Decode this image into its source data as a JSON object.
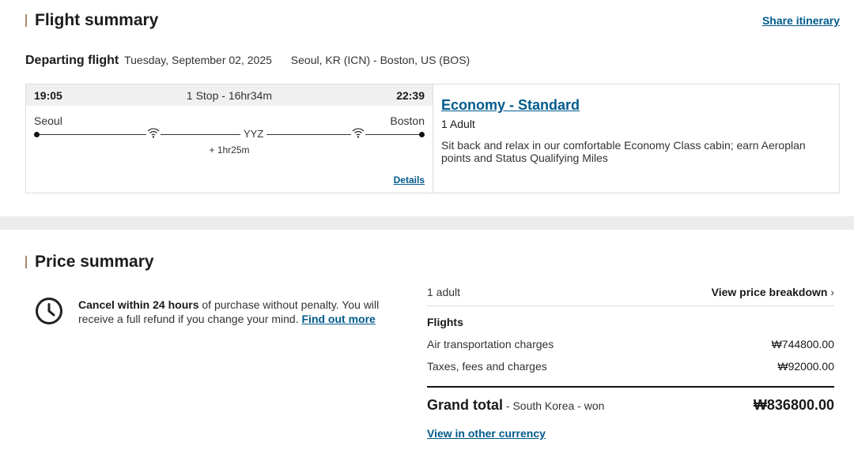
{
  "flight_summary": {
    "title": "Flight summary",
    "share_link": "Share itinerary",
    "departing_label": "Departing flight",
    "date": "Tuesday, September 02, 2025",
    "route": "Seoul, KR (ICN) - Boston, US (BOS)",
    "segment": {
      "dep_time": "19:05",
      "stops": "1 Stop - 16hr34m",
      "arr_time": "22:39",
      "dep_city": "Seoul",
      "arr_city": "Boston",
      "stop_code": "YYZ",
      "layover": "+ 1hr25m",
      "details_link": "Details"
    },
    "fare": {
      "title": "Economy - Standard",
      "passengers": "1 Adult",
      "description": "Sit back and relax in our comfortable Economy Class cabin; earn Aeroplan points and Status Qualifying Miles"
    }
  },
  "price_summary": {
    "title": "Price summary",
    "cancel_bold": "Cancel within 24 hours",
    "cancel_text": " of purchase without penalty. You will receive a full refund if you change your mind. ",
    "find_out_more": "Find out more",
    "passengers": "1 adult",
    "breakdown_link": "View price breakdown",
    "breakdown_chevron": "›",
    "flights_heading": "Flights",
    "items": [
      {
        "label": "Air transportation charges",
        "amount": "₩744800.00"
      },
      {
        "label": "Taxes, fees and charges",
        "amount": "₩92000.00"
      }
    ],
    "grand_total_label": "Grand total",
    "grand_total_sub": " - South Korea - won",
    "grand_total_amount": "₩836800.00",
    "other_currency_link": "View in other currency"
  },
  "icons": {
    "clock": "clock-icon",
    "wifi": "wifi-icon",
    "chevron": "chevron-right-icon"
  },
  "colors": {
    "accent_link": "#005a8c",
    "section_bar": "#a88c6a",
    "background": "#ececec"
  }
}
